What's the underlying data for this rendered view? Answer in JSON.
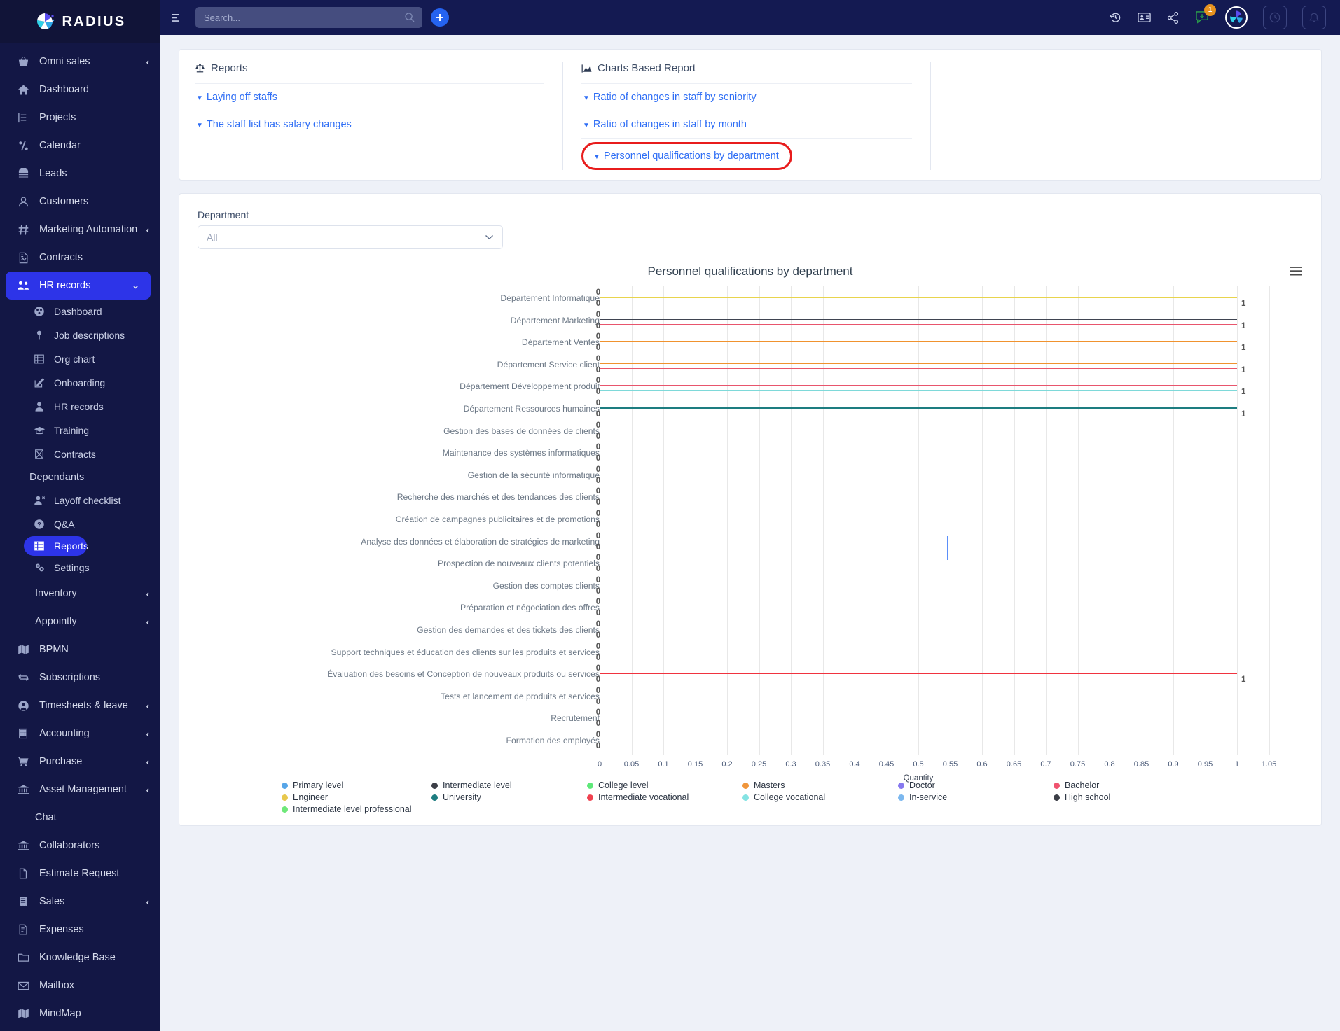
{
  "brand": {
    "name": "RADIUS"
  },
  "topbar": {
    "search_placeholder": "Search...",
    "notification_count": "1"
  },
  "sidebar": {
    "items": [
      {
        "label": "Omni sales",
        "icon": "basket-icon",
        "chevron": "‹",
        "type": "item"
      },
      {
        "label": "Dashboard",
        "icon": "home-icon",
        "chevron": "",
        "type": "item"
      },
      {
        "label": "Projects",
        "icon": "projects-icon",
        "chevron": "",
        "type": "item"
      },
      {
        "label": "Calendar",
        "icon": "calendar-icon",
        "chevron": "",
        "type": "item"
      },
      {
        "label": "Leads",
        "icon": "leads-icon",
        "chevron": "",
        "type": "item"
      },
      {
        "label": "Customers",
        "icon": "user-icon",
        "chevron": "",
        "type": "item"
      },
      {
        "label": "Marketing Automation",
        "icon": "hash-icon",
        "chevron": "‹",
        "type": "item"
      },
      {
        "label": "Contracts",
        "icon": "document-icon",
        "chevron": "",
        "type": "item"
      },
      {
        "label": "HR records",
        "icon": "people-icon",
        "chevron": "⌄",
        "type": "active"
      },
      {
        "label": "Dashboard",
        "icon": "gauge-icon",
        "type": "sub"
      },
      {
        "label": "Job descriptions",
        "icon": "pin-icon",
        "type": "sub"
      },
      {
        "label": "Org chart",
        "icon": "list-icon",
        "type": "sub"
      },
      {
        "label": "Onboarding",
        "icon": "edit-icon",
        "type": "sub"
      },
      {
        "label": "HR records",
        "icon": "person-icon",
        "type": "sub"
      },
      {
        "label": "Training",
        "icon": "graduation-icon",
        "type": "sub"
      },
      {
        "label": "Contracts",
        "icon": "contract-icon",
        "type": "sub"
      },
      {
        "label": "Dependants",
        "icon": "",
        "type": "sublabel"
      },
      {
        "label": "Layoff checklist",
        "icon": "user-remove-icon",
        "type": "sub"
      },
      {
        "label": "Q&A",
        "icon": "question-icon",
        "type": "sub"
      },
      {
        "label": "Reports",
        "icon": "report-icon",
        "type": "subactive"
      },
      {
        "label": "Settings",
        "icon": "gears-icon",
        "type": "sub"
      },
      {
        "label": "Inventory",
        "icon": "",
        "chevron": "‹",
        "type": "plain"
      },
      {
        "label": "Appointly",
        "icon": "",
        "chevron": "‹",
        "type": "plain"
      },
      {
        "label": "BPMN",
        "icon": "map-icon",
        "chevron": "",
        "type": "item"
      },
      {
        "label": "Subscriptions",
        "icon": "refresh-icon",
        "chevron": "",
        "type": "item"
      },
      {
        "label": "Timesheets & leave",
        "icon": "clock-user-icon",
        "chevron": "‹",
        "type": "item"
      },
      {
        "label": "Accounting",
        "icon": "calculator-icon",
        "chevron": "‹",
        "type": "item"
      },
      {
        "label": "Purchase",
        "icon": "cart-icon",
        "chevron": "‹",
        "type": "item"
      },
      {
        "label": "Asset Management",
        "icon": "bank-icon",
        "chevron": "‹",
        "type": "item"
      },
      {
        "label": "Chat",
        "icon": "",
        "chevron": "",
        "type": "plain"
      },
      {
        "label": "Collaborators",
        "icon": "bank-icon",
        "chevron": "",
        "type": "item"
      },
      {
        "label": "Estimate Request",
        "icon": "file-icon",
        "chevron": "",
        "type": "item"
      },
      {
        "label": "Sales",
        "icon": "receipt-icon",
        "chevron": "‹",
        "type": "item"
      },
      {
        "label": "Expenses",
        "icon": "expense-icon",
        "chevron": "",
        "type": "item"
      },
      {
        "label": "Knowledge Base",
        "icon": "folder-icon",
        "chevron": "",
        "type": "item"
      },
      {
        "label": "Mailbox",
        "icon": "mail-icon",
        "chevron": "",
        "type": "item"
      },
      {
        "label": "MindMap",
        "icon": "map-icon",
        "chevron": "",
        "type": "item"
      }
    ]
  },
  "reports_panel": {
    "columns": [
      {
        "heading": "Reports",
        "heading_icon": "scales-icon",
        "items": [
          {
            "label": "Laying off staffs",
            "highlighted": false
          },
          {
            "label": "The staff list has salary changes",
            "highlighted": false
          }
        ]
      },
      {
        "heading": "Charts Based Report",
        "heading_icon": "chart-icon",
        "items": [
          {
            "label": "Ratio of changes in staff by seniority",
            "highlighted": false
          },
          {
            "label": "Ratio of changes in staff by month",
            "highlighted": false
          },
          {
            "label": "Personnel qualifications by department",
            "highlighted": true
          }
        ]
      }
    ],
    "highlight_color": "#e81c1c"
  },
  "filter": {
    "label": "Department",
    "value": "All",
    "options": [
      "All"
    ]
  },
  "chart_data": {
    "type": "bar",
    "title": "Personnel qualifications by department",
    "xlabel": "Quantity",
    "ylabel": "",
    "xlim": [
      0,
      1.05
    ],
    "grid": true,
    "legend_position": "bottom",
    "xticks": [
      "0",
      "0.05",
      "0.1",
      "0.15",
      "0.2",
      "0.25",
      "0.3",
      "0.35",
      "0.4",
      "0.45",
      "0.5",
      "0.55",
      "0.6",
      "0.65",
      "0.7",
      "0.75",
      "0.8",
      "0.85",
      "0.9",
      "0.95",
      "1",
      "1.05"
    ],
    "categories": [
      "Département Informatique",
      "Département Marketing",
      "Département Ventes",
      "Département Service client",
      "Département Développement produit",
      "Département Ressources humaines",
      "Gestion des bases de données de clients",
      "Maintenance des systèmes informatiques",
      "Gestion de la sécurité informatique",
      "Recherche des marchés et des tendances des clients",
      "Création de campagnes publicitaires et de promotions",
      "Analyse des données et élaboration de stratégies de marketing",
      "Prospection de nouveaux clients potentiels",
      "Gestion des comptes clients",
      "Préparation et négociation des offres",
      "Gestion des demandes et des tickets des clients",
      "Support techniques et éducation des clients sur les produits et services",
      "Évaluation des besoins et Conception de nouveaux produits ou services",
      "Tests et lancement de produits et services",
      "Recrutement",
      "Formation des employés"
    ],
    "value_labels_left": [
      [
        "0",
        "0"
      ],
      [
        "0",
        "0"
      ],
      [
        "0",
        "0"
      ],
      [
        "0",
        "0"
      ],
      [
        "0",
        "0"
      ],
      [
        "0",
        "0"
      ],
      [
        "0",
        "0"
      ],
      [
        "0",
        "0"
      ],
      [
        "0",
        "0"
      ],
      [
        "0",
        "0"
      ],
      [
        "0",
        "0"
      ],
      [
        "0",
        "0"
      ],
      [
        "0",
        "0"
      ],
      [
        "0",
        "0"
      ],
      [
        "0",
        "0"
      ],
      [
        "0",
        "0"
      ],
      [
        "0",
        "0"
      ],
      [
        "0",
        "0"
      ],
      [
        "0",
        "0"
      ],
      [
        "0",
        "0"
      ],
      [
        "0",
        "0"
      ]
    ],
    "value_labels_right": {
      "0": "1",
      "1": "1",
      "2": "1",
      "3": "1",
      "4": "1",
      "5": "1",
      "17": "1"
    },
    "bars": [
      {
        "category_index": 0,
        "value": 1,
        "color": "#e8d44d",
        "label": "1"
      },
      {
        "category_index": 1,
        "value": 1,
        "color": "#3f4451",
        "label": "1"
      },
      {
        "category_index": 1,
        "value": 1,
        "color": "#e8556d",
        "label": "1"
      },
      {
        "category_index": 2,
        "value": 1,
        "color": "#f0922e",
        "label": "1"
      },
      {
        "category_index": 3,
        "value": 1,
        "color": "#f0922e",
        "label": "1"
      },
      {
        "category_index": 3,
        "value": 1,
        "color": "#e8556d",
        "label": "1"
      },
      {
        "category_index": 4,
        "value": 1,
        "color": "#e8556d",
        "label": "1"
      },
      {
        "category_index": 4,
        "value": 1,
        "color": "#7ed9d9",
        "label": "1"
      },
      {
        "category_index": 5,
        "value": 1,
        "color": "#1d7d80",
        "label": "1"
      },
      {
        "category_index": 17,
        "value": 1,
        "color": "#f0333f",
        "label": "1"
      }
    ],
    "legend": [
      {
        "label": "Primary level",
        "color": "#57a6e8"
      },
      {
        "label": "Engineer",
        "color": "#e8c84d"
      },
      {
        "label": "Intermediate level professional",
        "color": "#6fe87a"
      },
      {
        "label": "Intermediate level",
        "color": "#3c3f47"
      },
      {
        "label": "University",
        "color": "#1d7d80"
      },
      {
        "label": "College level",
        "color": "#5ee879"
      },
      {
        "label": "Intermediate vocational",
        "color": "#f0414f"
      },
      {
        "label": "Masters",
        "color": "#f0963c"
      },
      {
        "label": "College vocational",
        "color": "#84e3e3"
      },
      {
        "label": "Doctor",
        "color": "#8779ef"
      },
      {
        "label": "In-service",
        "color": "#7cb8ef"
      },
      {
        "label": "Bachelor",
        "color": "#f0536f"
      },
      {
        "label": "High school",
        "color": "#3c3f47"
      }
    ]
  }
}
